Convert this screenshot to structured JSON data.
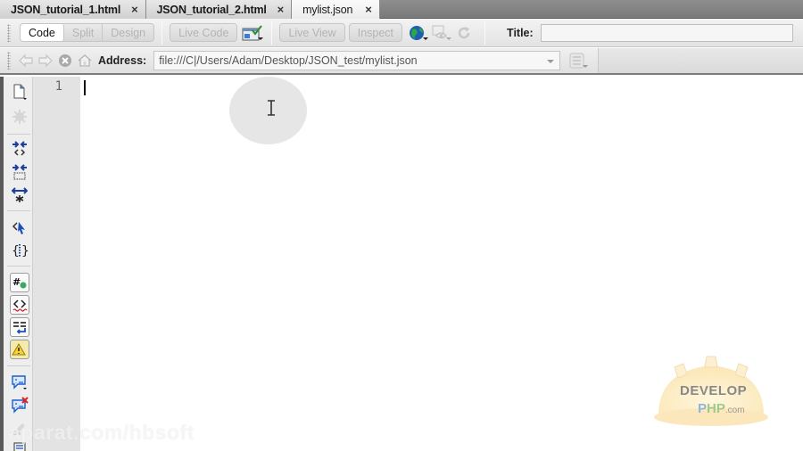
{
  "tabs": [
    {
      "label": "JSON_tutorial_1.html",
      "active": false
    },
    {
      "label": "JSON_tutorial_2.html",
      "active": false
    },
    {
      "label": "mylist.json",
      "active": true
    }
  ],
  "tab_close_glyph": "×",
  "doc_toolbar": {
    "view_buttons": [
      "Code",
      "Split",
      "Design"
    ],
    "active_view": "Code",
    "live_code_label": "Live Code",
    "live_view_label": "Live View",
    "inspect_label": "Inspect",
    "title_label": "Title:",
    "title_value": ""
  },
  "nav_toolbar": {
    "address_label": "Address:",
    "address_value": "file:///C|/Users/Adam/Desktop/JSON_test/mylist.json"
  },
  "editor": {
    "line_numbers": [
      "1"
    ],
    "content": ""
  },
  "watermarks": {
    "aparat": "aparat.com/hbsoft",
    "logo_line1": "DEVELOP",
    "logo_p": "P",
    "logo_hp": "HP",
    "logo_domain": ".com"
  },
  "colors": {
    "tab_bar": "#7a7a7a",
    "toolbar_bg": "#e8e8e8",
    "gutter_bg": "#e3e3e3",
    "editor_bg": "#ffffff",
    "globe": "#1f8a3c"
  }
}
